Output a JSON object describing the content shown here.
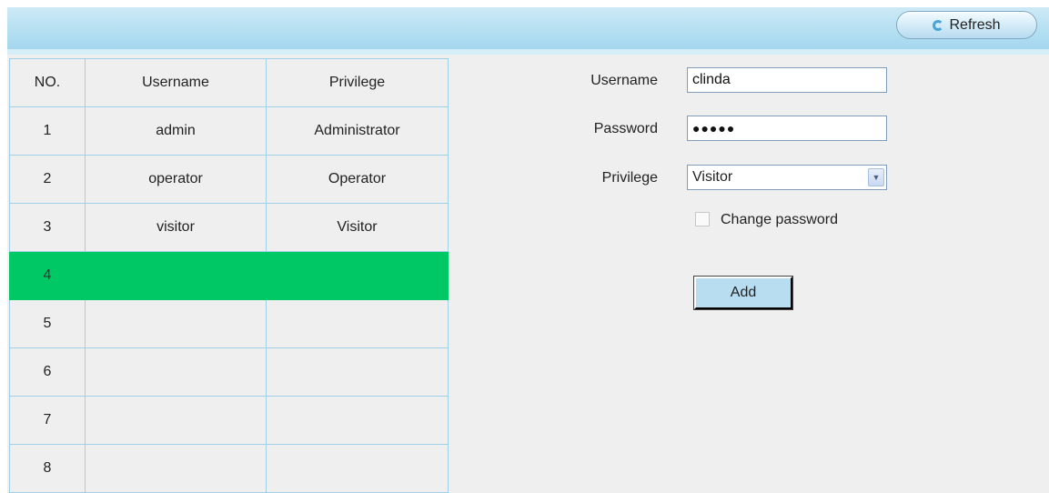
{
  "toolbar": {
    "refresh_label": "Refresh"
  },
  "table": {
    "headers": [
      "NO.",
      "Username",
      "Privilege"
    ],
    "rows": [
      {
        "no": "1",
        "username": "admin",
        "privilege": "Administrator"
      },
      {
        "no": "2",
        "username": "operator",
        "privilege": "Operator"
      },
      {
        "no": "3",
        "username": "visitor",
        "privilege": "Visitor"
      },
      {
        "no": "4",
        "username": "",
        "privilege": ""
      },
      {
        "no": "5",
        "username": "",
        "privilege": ""
      },
      {
        "no": "6",
        "username": "",
        "privilege": ""
      },
      {
        "no": "7",
        "username": "",
        "privilege": ""
      },
      {
        "no": "8",
        "username": "",
        "privilege": ""
      }
    ],
    "selected_row": 4,
    "selected_color": "#00c865"
  },
  "form": {
    "username_label": "Username",
    "username_value": "clinda",
    "password_label": "Password",
    "password_value": "●●●●●",
    "privilege_label": "Privilege",
    "privilege_value": "Visitor",
    "change_password_label": "Change password",
    "change_password_checked": false,
    "add_label": "Add"
  }
}
